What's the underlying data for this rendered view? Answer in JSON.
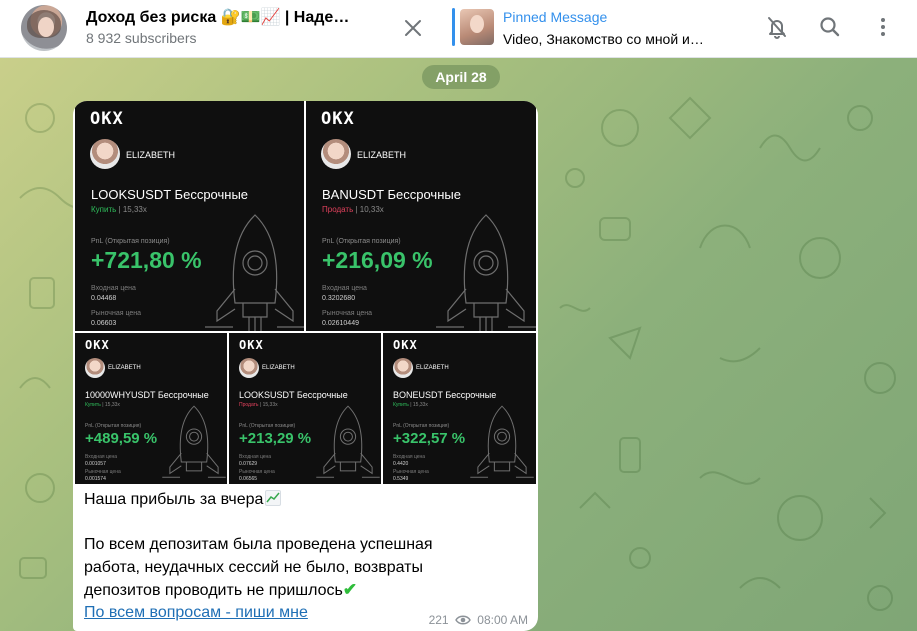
{
  "header": {
    "channel_title": "Доход без риска 🔐💵📈 | Наде…",
    "subscribers": "8 932 subscribers",
    "pinned": {
      "label": "Pinned Message",
      "text": "Video, Знакомство со мной и…"
    },
    "icons": [
      "close-icon",
      "bell-muted-icon",
      "search-icon",
      "more-vertical-icon"
    ]
  },
  "chat": {
    "date": "April 28"
  },
  "message": {
    "cards": [
      {
        "logo": "OKX",
        "user": "ELIZABETH",
        "pair": "LOOKSUSDT Бессрочные",
        "side": "Купить",
        "leverage": "15,33x",
        "pnl_label": "PnL (Открытая позиция)",
        "pnl": "+721,80 %",
        "entry_label": "Входная цена",
        "entry": "0.04468",
        "market_label": "Рыночная цена",
        "market": "0.06603"
      },
      {
        "logo": "OKX",
        "user": "ELIZABETH",
        "pair": "BANUSDT Бессрочные",
        "side": "Продать",
        "leverage": "10,33x",
        "pnl_label": "PnL (Открытая позиция)",
        "pnl": "+216,09 %",
        "entry_label": "Входная цена",
        "entry": "0.3202680",
        "market_label": "Рыночная цена",
        "market": "0.02610449"
      },
      {
        "logo": "OKX",
        "user": "ELIZABETH",
        "pair": "10000WHYUSDT Бессрочные",
        "side": "Купить",
        "leverage": "15,33x",
        "pnl_label": "PnL (Открытая позиция)",
        "pnl": "+489,59 %",
        "entry_label": "Входная цена",
        "entry": "0.001057",
        "market_label": "Рыночная цена",
        "market": "0.001574"
      },
      {
        "logo": "OKX",
        "user": "ELIZABETH",
        "pair": "LOOKSUSDT Бессрочные",
        "side": "Продать",
        "leverage": "15,33x",
        "pnl_label": "PnL (Открытая позиция)",
        "pnl": "+213,29 %",
        "entry_label": "Входная цена",
        "entry": "0.07629",
        "market_label": "Рыночная цена",
        "market": "0.06565"
      },
      {
        "logo": "OKX",
        "user": "ELIZABETH",
        "pair": "BONEUSDT Бессрочные",
        "side": "Купить",
        "leverage": "15,33x",
        "pnl_label": "PnL (Открытая позиция)",
        "pnl": "+322,57 %",
        "entry_label": "Входная цена",
        "entry": "0.4420",
        "market_label": "Рыночная цена",
        "market": "0.5349"
      }
    ],
    "text_line1": "Наша прибыль за вчера",
    "text_line2": "По всем депозитам была проведена успешная",
    "text_line3": "работа, неудачных сессий не было, возвраты",
    "text_line4": "депозитов проводить не пришлось",
    "check_emoji": "✔",
    "link": "По всем вопросам - пиши мне",
    "views": "221",
    "time": "08:00 AM"
  },
  "colors": {
    "accent": "#3390ec",
    "pnl_green": "#39c36a",
    "buy_green": "#2fbd5b",
    "sell_red": "#e0415c",
    "card_bg": "#0f0f0f",
    "link": "#1f6fb5"
  }
}
